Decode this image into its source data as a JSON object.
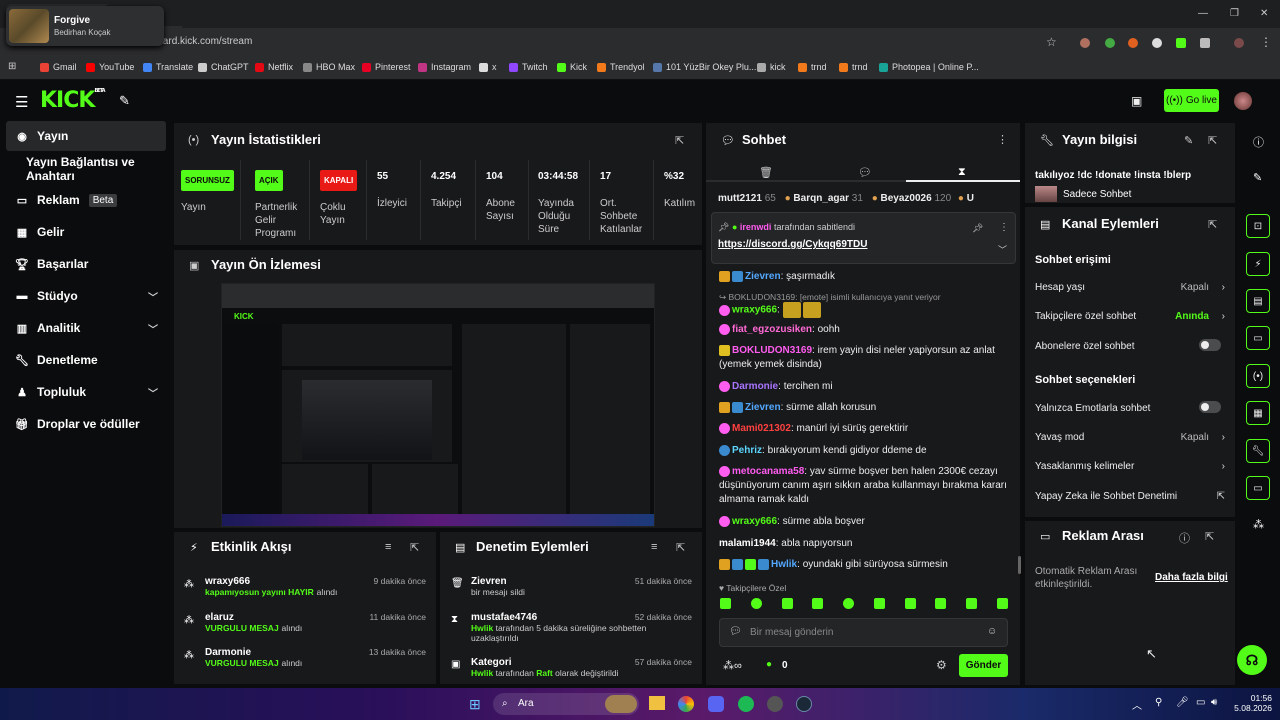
{
  "browser": {
    "media_title": "Forgive",
    "media_artist": "Bedirhan Koçak",
    "url": "dashboard.kick.com/stream",
    "bookmarks": [
      "Gmail",
      "YouTube",
      "Translate",
      "ChatGPT",
      "Netflix",
      "HBO Max",
      "Pinterest",
      "Instagram",
      "x",
      "Twitch",
      "Kick",
      "Trendyol",
      "101 YüzBir Okey Plu...",
      "kick",
      "trnd",
      "trnd",
      "Photopea | Online P..."
    ]
  },
  "header": {
    "logo": "KICK",
    "logo_sup": "BETA",
    "go_live": "Go live"
  },
  "sidebar": {
    "items": [
      "Yayın",
      "Yayın Bağlantısı ve Anahtarı",
      "Reklam",
      "Gelir",
      "Başarılar",
      "Stüdyo",
      "Analitik",
      "Denetleme",
      "Topluluk",
      "Droplar ve ödüller"
    ],
    "beta": "Beta"
  },
  "stats": {
    "title": "Yayın İstatistikleri",
    "b1": "SORUNSUZ",
    "l1": "Yayın",
    "b2": "AÇIK",
    "l2": "Partnerlik Gelir Programı",
    "b3": "KAPALI",
    "l3": "Çoklu Yayın",
    "v4": "55",
    "l4": "İzleyici",
    "v5": "4.254",
    "l5": "Takipçi",
    "v6": "104",
    "l6": "Abone Sayısı",
    "v7": "03:44:58",
    "l7": "Yayında Olduğu Süre",
    "v8": "17",
    "l8": "Ort. Sohbete Katılanlar",
    "v9": "%32",
    "l9": "Katılım"
  },
  "preview": {
    "title": "Yayın Ön İzlemesi"
  },
  "activity": {
    "title": "Etkinlik Akışı",
    "items": [
      {
        "name": "wraxy666",
        "desc": "kapamıyosun yayını HAYIR",
        "suffix": "alındı",
        "time": "9 dakika önce"
      },
      {
        "name": "elaruz",
        "desc": "VURGULU MESAJ",
        "suffix": "alındı",
        "time": "11 dakika önce"
      },
      {
        "name": "Darmonie",
        "desc": "VURGULU MESAJ",
        "suffix": "alındı",
        "time": "13 dakika önce"
      }
    ]
  },
  "moderation": {
    "title": "Denetim Eylemleri",
    "items": [
      {
        "name": "Zievren",
        "desc": "bir mesajı sildi",
        "time": "51 dakika önce"
      },
      {
        "name": "mustafae4746",
        "desc1": "Hwlik",
        "desc2": "tarafından 5 dakika süreliğine sohbetten uzaklaştırıldı",
        "time": "52 dakika önce"
      },
      {
        "name": "Kategori",
        "desc1": "Hwlik",
        "desc2": "tarafından",
        "desc3": "Raft",
        "desc4": "olarak değiştirildi",
        "time": "57 dakika önce"
      }
    ]
  },
  "chat": {
    "title": "Sohbet",
    "leaders": [
      {
        "n": "mutt2121",
        "v": "65"
      },
      {
        "n": "Barqn_agar",
        "v": "31"
      },
      {
        "n": "Beyaz0026",
        "v": "120"
      },
      {
        "n": "U",
        "v": ""
      }
    ],
    "pinned_by": "irenwdi",
    "pinned_suffix": "tarafından sabitlendi",
    "pinned_link": "https://discord.gg/Cykqq69TDU",
    "messages": [
      {
        "u": "Zievren",
        "c": "#53a8ff",
        "t": "şaşırmadık"
      },
      {
        "reply": "BOKLUDON3169: [emote] isimli kullanıcıya yanıt veriyor"
      },
      {
        "u": "wraxy666",
        "c": "#53fc18",
        "t": ""
      },
      {
        "u": "fiat_egzozusiken",
        "c": "#ff6ad5",
        "t": "oohh"
      },
      {
        "u": "BOKLUDON3169",
        "c": "#ff5cf0",
        "t": "irem yayin disi neler yapiyorsun az anlat (yemek yemek disinda)"
      },
      {
        "u": "Darmonie",
        "c": "#a875ff",
        "t": "tercihen mi"
      },
      {
        "u": "Zievren",
        "c": "#53a8ff",
        "t": "sürme allah korusun"
      },
      {
        "u": "Mami021302",
        "c": "#ff4040",
        "t": "manürl iyi sürüş gerektirir"
      },
      {
        "u": "Pehriz",
        "c": "#5cd6ff",
        "t": "bırakıyorum kendi gidiyor ddeme de"
      },
      {
        "u": "metocanama58",
        "c": "#ff5cf0",
        "t": "yav sürme boşver ben halen 2300€ cezayı düşünüyorum canım aşırı sıkkın araba kullanmayı bırakma kararı almama ramak kaldı"
      },
      {
        "u": "wraxy666",
        "c": "#53fc18",
        "t": "sürme abla boşver"
      },
      {
        "u": "malami1944",
        "c": "#fff",
        "t": "abla napıyorsun"
      },
      {
        "u": "Hwlik",
        "c": "#53a8ff",
        "t": "oyundaki gibi sürüyosa sürmesin"
      }
    ],
    "followers_only": "Takipçilere Özel",
    "placeholder": "Bir mesaj gönderin",
    "send": "Gönder",
    "count": "0"
  },
  "info": {
    "title": "Yayın bilgisi",
    "stream_title": "takılıyoz !dc !donate !insta !blerp",
    "category": "Sadece Sohbet"
  },
  "channel": {
    "title": "Kanal Eylemleri",
    "access": "Sohbet erişimi",
    "r1": "Hesap yaşı",
    "r1v": "Kapalı",
    "r2": "Takipçilere özel sohbet",
    "r2v": "Anında",
    "r3": "Abonelere özel sohbet",
    "options": "Sohbet seçenekleri",
    "r4": "Yalnızca Emotlarla sohbet",
    "r5": "Yavaş mod",
    "r5v": "Kapalı",
    "r6": "Yasaklanmış kelimeler",
    "r7": "Yapay Zeka ile Sohbet Denetimi"
  },
  "ads": {
    "title": "Reklam Arası",
    "desc": "Otomatik Reklam Arası etkinleştirildi.",
    "more": "Daha fazla bilgi"
  },
  "taskbar": {
    "search": "Ara",
    "time": "01:56",
    "date": "5.08.2026"
  }
}
